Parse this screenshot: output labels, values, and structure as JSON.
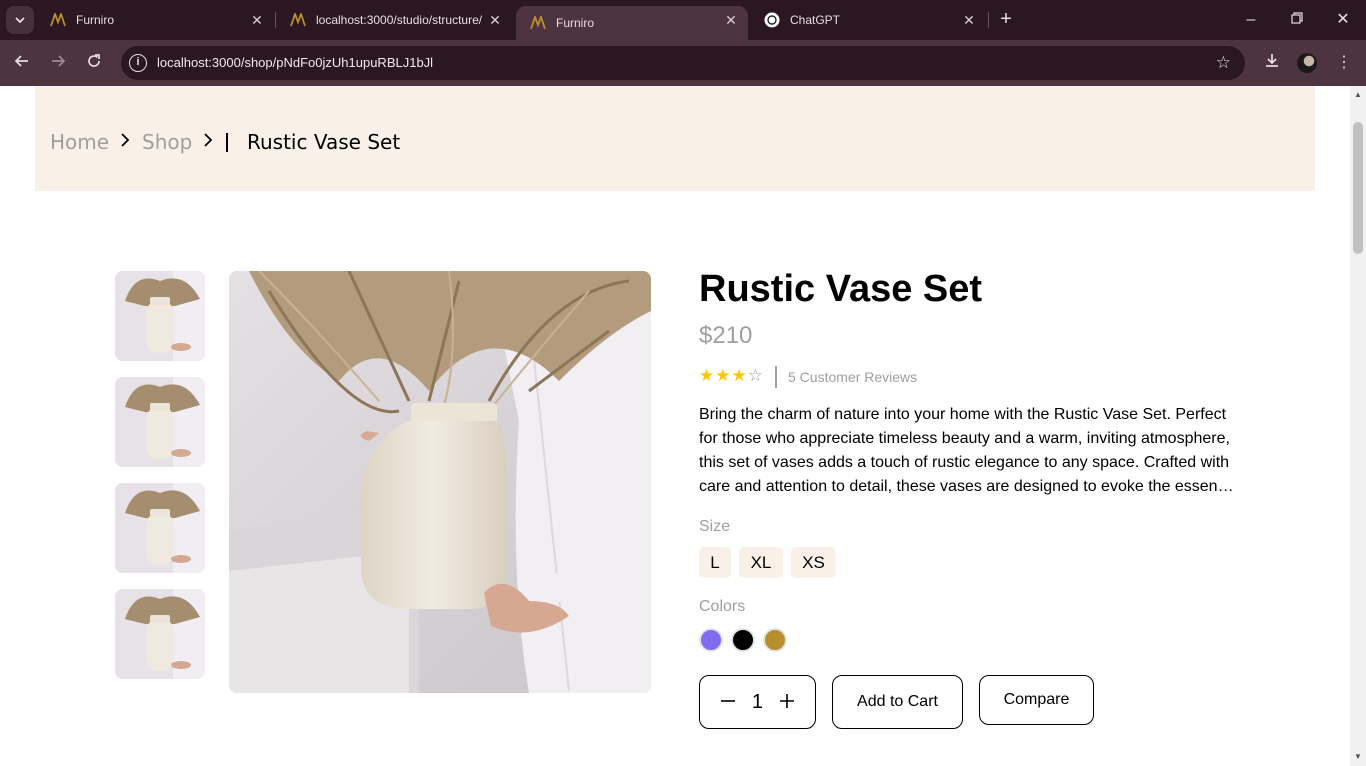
{
  "browser": {
    "tabs": [
      {
        "title": "Furniro",
        "active": false
      },
      {
        "title": "localhost:3000/studio/structure/",
        "active": false
      },
      {
        "title": "Furniro",
        "active": true
      },
      {
        "title": "ChatGPT",
        "active": false
      }
    ],
    "url": "localhost:3000/shop/pNdFo0jzUh1upuRBLJ1bJl"
  },
  "breadcrumb": {
    "home": "Home",
    "shop": "Shop",
    "current": "Rustic Vase Set"
  },
  "product": {
    "title": "Rustic Vase Set",
    "price": "$210",
    "rating": 3,
    "rating_max": 5,
    "reviews": "5 Customer Reviews",
    "description": "Bring the charm of nature into your home with the Rustic Vase Set. Perfect for those who appreciate timeless beauty and a warm, inviting atmosphere, this set of vases adds a touch of rustic elegance to any space. Crafted with care and attention to detail, these vases are designed to evoke the essence of nature.",
    "size_label": "Size",
    "sizes": [
      "L",
      "XL",
      "XS"
    ],
    "colors_label": "Colors",
    "colors": [
      "#7f6cf0",
      "#000000",
      "#b88e2f"
    ],
    "quantity": "1",
    "add_to_cart": "Add to Cart",
    "compare": "Compare"
  },
  "icons": {
    "tab_search": "chevron-down-icon",
    "back": "arrow-left-icon",
    "forward": "arrow-right-icon",
    "reload": "reload-icon",
    "bookmark": "star-outline-icon",
    "download": "download-icon",
    "menu": "kebab-icon"
  }
}
